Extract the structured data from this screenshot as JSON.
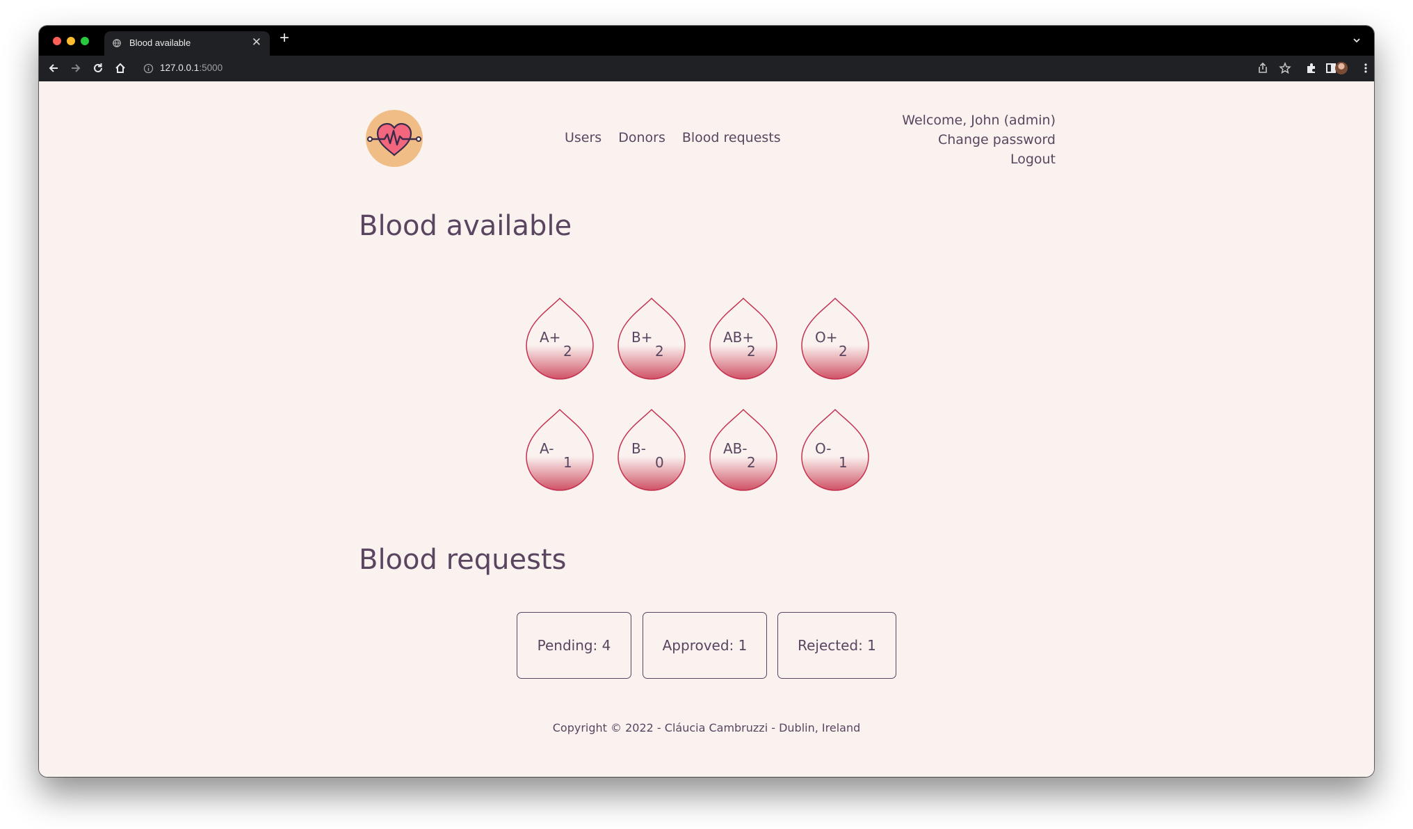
{
  "browser": {
    "tab_title": "Blood available",
    "url_host": "127.0.0.1",
    "url_rest": ":5000",
    "new_tab_label": "+",
    "close_tab_label": "✕"
  },
  "nav": {
    "users": "Users",
    "donors": "Donors",
    "blood_requests": "Blood requests"
  },
  "user_menu": {
    "welcome": "Welcome, John (admin)",
    "change_password": "Change password",
    "logout": "Logout"
  },
  "blood_available": {
    "title": "Blood available",
    "types": [
      {
        "type": "A+",
        "count": "2"
      },
      {
        "type": "B+",
        "count": "2"
      },
      {
        "type": "AB+",
        "count": "2"
      },
      {
        "type": "O+",
        "count": "2"
      },
      {
        "type": "A-",
        "count": "1"
      },
      {
        "type": "B-",
        "count": "0"
      },
      {
        "type": "AB-",
        "count": "2"
      },
      {
        "type": "O-",
        "count": "1"
      }
    ]
  },
  "blood_requests": {
    "title": "Blood requests",
    "pending": "Pending: 4",
    "approved": "Approved: 1",
    "rejected": "Rejected: 1"
  },
  "footer": "Copyright © 2022 - Cláucia Cambruzzi - Dublin, Ireland",
  "colors": {
    "page_bg": "#faf2ef",
    "text": "#5a4560",
    "drop_stroke": "#c4304e",
    "drop_fill": "#cf5266",
    "logo_bg": "#f0bd86",
    "heart": "#f2667e"
  }
}
